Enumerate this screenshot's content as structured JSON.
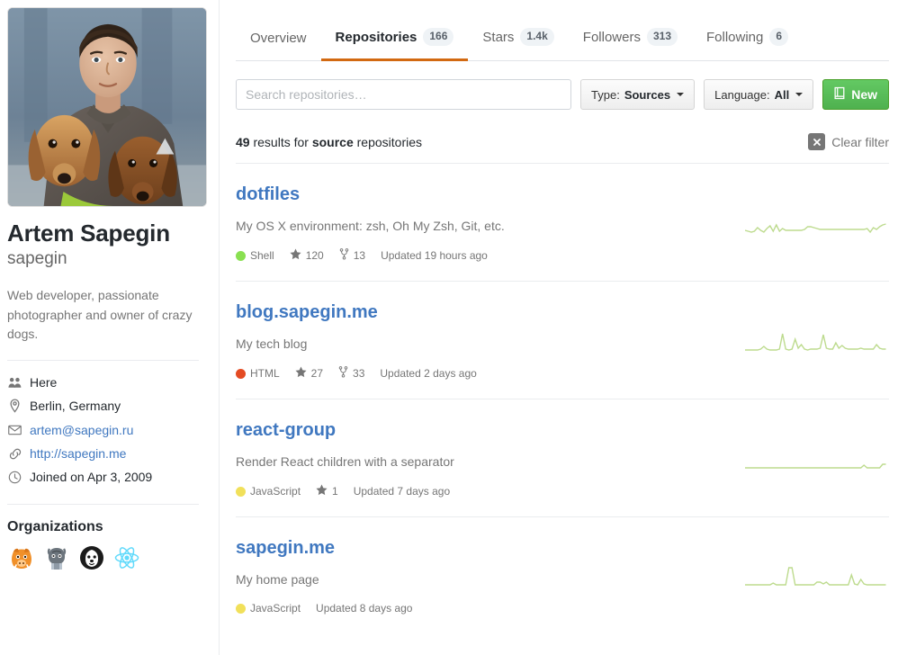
{
  "profile": {
    "avatar_alt": "Photo of Artem Sapegin holding two dachshunds in winter",
    "name": "Artem Sapegin",
    "login": "sapegin",
    "bio": "Web developer, passionate photographer and owner of crazy dogs.",
    "meta": [
      {
        "icon": "organization-icon",
        "text": "Here",
        "link": false
      },
      {
        "icon": "location-pin-icon",
        "text": "Berlin, Germany",
        "link": false
      },
      {
        "icon": "mail-icon",
        "text": "artem@sapegin.ru",
        "link": true
      },
      {
        "icon": "link-icon",
        "text": "http://sapegin.me",
        "link": true
      },
      {
        "icon": "clock-icon",
        "text": "Joined on Apr 3, 2009",
        "link": false
      }
    ],
    "organizations_title": "Organizations",
    "organizations": [
      {
        "name": "boar-org-avatar",
        "color": "#f0902a"
      },
      {
        "name": "octocat-org-avatar",
        "color": "#6c757d"
      },
      {
        "name": "dog-org-avatar",
        "color": "#1b1b1b"
      },
      {
        "name": "react-org-avatar",
        "color": "#61dafb"
      }
    ]
  },
  "tabs": [
    {
      "label": "Overview",
      "count": null,
      "active": false
    },
    {
      "label": "Repositories",
      "count": "166",
      "active": true
    },
    {
      "label": "Stars",
      "count": "1.4k",
      "active": false
    },
    {
      "label": "Followers",
      "count": "313",
      "active": false
    },
    {
      "label": "Following",
      "count": "6",
      "active": false
    }
  ],
  "filters": {
    "search_placeholder": "Search repositories…",
    "search_value": "",
    "type_label": "Type:",
    "type_value": "Sources",
    "language_label": "Language:",
    "language_value": "All",
    "new_button": "New"
  },
  "results": {
    "count": "49",
    "prefix": "results for",
    "highlight": "source",
    "suffix": "repositories",
    "clear_filter": "Clear filter"
  },
  "accent": {
    "tab_underline": "#d26911",
    "link": "#4078c0",
    "new_button": "#4fb14f",
    "spark_line": "#bddb8e"
  },
  "repositories": [
    {
      "name": "dotfiles",
      "description": "My OS X environment: zsh, Oh My Zsh, Git, etc.",
      "language": "Shell",
      "language_color": "#89e051",
      "stars": "120",
      "forks": "13",
      "updated": "Updated 19 hours ago",
      "sparkline": [
        6,
        5,
        4,
        5,
        9,
        6,
        4,
        8,
        11,
        5,
        12,
        5,
        8,
        6,
        6,
        6,
        6,
        6,
        6,
        7,
        10,
        10,
        9,
        8,
        7,
        7,
        7,
        7,
        7,
        7,
        7,
        7,
        7,
        7,
        7,
        7,
        7,
        7,
        7,
        8,
        4,
        9,
        7,
        10,
        12,
        13
      ]
    },
    {
      "name": "blog.sapegin.me",
      "description": "My tech blog",
      "language": "HTML",
      "language_color": "#e44b23",
      "stars": "27",
      "forks": "33",
      "updated": "Updated 2 days ago",
      "sparkline": [
        3,
        3,
        3,
        3,
        3,
        4,
        7,
        4,
        3,
        3,
        3,
        4,
        18,
        4,
        3,
        4,
        12,
        5,
        8,
        4,
        3,
        4,
        4,
        4,
        5,
        17,
        5,
        4,
        4,
        10,
        5,
        7,
        5,
        4,
        4,
        4,
        4,
        5,
        4,
        4,
        4,
        4,
        8,
        5,
        4,
        4
      ]
    },
    {
      "name": "react-group",
      "description": "Render React children with a separator",
      "language": "JavaScript",
      "language_color": "#f1e05a",
      "stars": "1",
      "forks": null,
      "updated": "Updated 7 days ago",
      "sparkline": [
        3,
        3,
        3,
        3,
        3,
        3,
        3,
        3,
        3,
        3,
        3,
        3,
        3,
        3,
        3,
        3,
        3,
        3,
        3,
        3,
        3,
        3,
        3,
        3,
        3,
        3,
        3,
        3,
        3,
        3,
        3,
        3,
        3,
        3,
        3,
        3,
        3,
        6,
        3,
        3,
        3,
        3,
        3,
        3,
        7,
        7
      ]
    },
    {
      "name": "sapegin.me",
      "description": "My home page",
      "language": "JavaScript",
      "language_color": "#f1e05a",
      "stars": null,
      "forks": null,
      "updated": "Updated 8 days ago",
      "sparkline": [
        4,
        4,
        4,
        4,
        4,
        4,
        4,
        4,
        4,
        6,
        4,
        4,
        4,
        4,
        20,
        20,
        4,
        4,
        4,
        4,
        4,
        4,
        4,
        7,
        7,
        5,
        7,
        4,
        4,
        4,
        4,
        4,
        4,
        4,
        12,
        5,
        4,
        9,
        5,
        4,
        4,
        4,
        4,
        4,
        4,
        4
      ]
    }
  ]
}
